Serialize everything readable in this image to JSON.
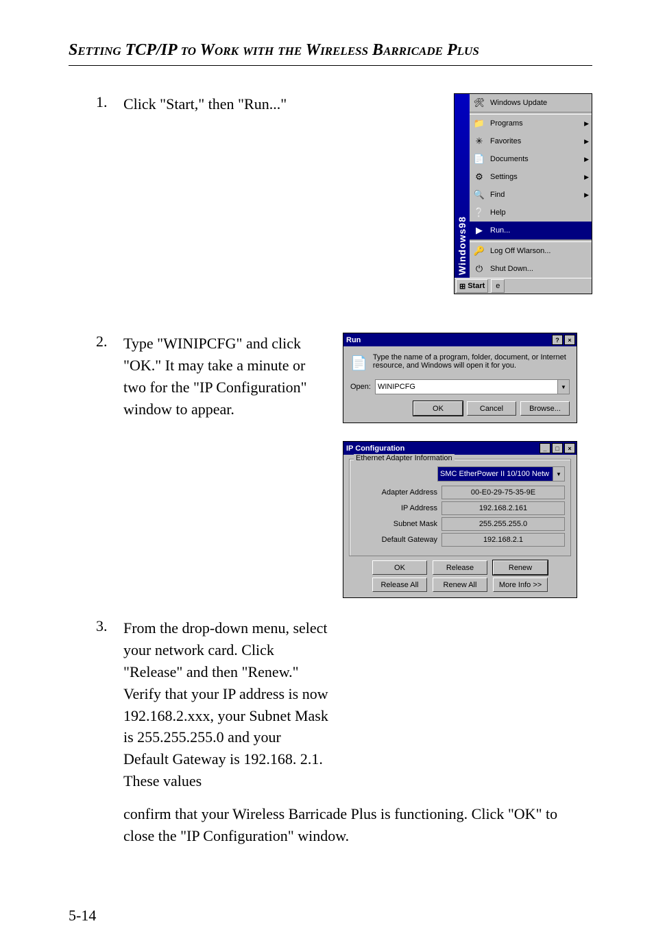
{
  "title": "Setting TCP/IP to Work with the Wireless Barricade Plus",
  "page_number": "5-14",
  "steps": [
    {
      "num": "1.",
      "text": "Click \"Start,\" then \"Run...\""
    },
    {
      "num": "2.",
      "text": "Type \"WINIPCFG\" and click \"OK.\" It may take a minute or two for the \"IP Configuration\" window to appear."
    },
    {
      "num": "3.",
      "text": "From the drop-down menu, select your network card. Click \"Release\" and then \"Renew.\" Verify that your IP address is now 192.168.2.xxx, your Subnet Mask is 255.255.255.0 and your Default Gateway is 192.168. 2.1. These values"
    }
  ],
  "continuation": "confirm that your Wireless Barricade Plus is functioning. Click \"OK\" to close the \"IP Configuration\" window.",
  "start_menu": {
    "side_label": "Windows98",
    "items": [
      {
        "label": "Windows Update",
        "arrow": false,
        "icon": "🛠"
      },
      {
        "label": "Programs",
        "arrow": true,
        "icon": "📁"
      },
      {
        "label": "Favorites",
        "arrow": true,
        "icon": "✳"
      },
      {
        "label": "Documents",
        "arrow": true,
        "icon": "📄"
      },
      {
        "label": "Settings",
        "arrow": true,
        "icon": "⚙"
      },
      {
        "label": "Find",
        "arrow": true,
        "icon": "🔍"
      },
      {
        "label": "Help",
        "arrow": false,
        "icon": "❔"
      },
      {
        "label": "Run...",
        "arrow": false,
        "icon": "▶",
        "selected": true
      },
      {
        "label": "Log Off Wlarson...",
        "arrow": false,
        "icon": "🔑"
      },
      {
        "label": "Shut Down...",
        "arrow": false,
        "icon": "⏻"
      }
    ],
    "start_button": "Start",
    "tray_icon": "e"
  },
  "run_dialog": {
    "title": "Run",
    "help_btn": "?",
    "close_btn": "×",
    "message": "Type the name of a program, folder, document, or Internet resource, and Windows will open it for you.",
    "open_label": "Open:",
    "open_value": "WINIPCFG",
    "ok": "OK",
    "cancel": "Cancel",
    "browse": "Browse..."
  },
  "ipcfg": {
    "title": "IP Configuration",
    "min_btn": "_",
    "max_btn": "□",
    "close_btn": "×",
    "group_title": "Ethernet Adapter Information",
    "nic": "SMC EtherPower II 10/100 Netw",
    "rows": {
      "adapter_label": "Adapter Address",
      "adapter_value": "00-E0-29-75-35-9E",
      "ip_label": "IP Address",
      "ip_value": "192.168.2.161",
      "mask_label": "Subnet Mask",
      "mask_value": "255.255.255.0",
      "gw_label": "Default Gateway",
      "gw_value": "192.168.2.1"
    },
    "buttons": {
      "ok": "OK",
      "release": "Release",
      "renew": "Renew",
      "release_all": "Release All",
      "renew_all": "Renew All",
      "more": "More Info >>"
    }
  }
}
